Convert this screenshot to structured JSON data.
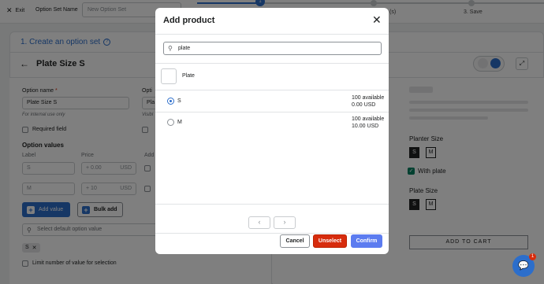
{
  "topbar": {
    "exit_label": "Exit",
    "option_set_name_label": "Option Set Name",
    "option_set_name_placeholder": "New Option Set",
    "step_current": "1",
    "step_2_partial": "(s)",
    "step_3_label": "3. Save"
  },
  "page": {
    "section_title": "1. Create an option set",
    "product_title": "Plate Size S",
    "option_name_label": "Option name",
    "option_name_required": "*",
    "option_name_value": "Plate Size S",
    "option_name_hint": "For internal use only",
    "option_title_label_partial": "Opti",
    "option_title_value_partial": "Pla",
    "option_title_hint_partial": "Visibl",
    "required_field_label": "Required field",
    "option_values_title": "Option values",
    "col_label": "Label",
    "col_price": "Price",
    "col_add_partial": "Add",
    "rows": [
      {
        "label": "S",
        "price": "0.00",
        "currency": "USD"
      },
      {
        "label": "M",
        "price": "10",
        "currency": "USD"
      }
    ],
    "add_value_label": "Add value",
    "bulk_add_label": "Bulk add",
    "default_option_placeholder": "Select default option value",
    "selected_tag": "S",
    "limit_label": "Limit number of value for selection"
  },
  "preview": {
    "planter_size_title": "Planter Size",
    "planter_swatches": [
      "S",
      "M"
    ],
    "with_plate_label": "With plate",
    "plate_size_title": "Plate Size",
    "plate_swatches": [
      "S",
      "M"
    ],
    "add_to_cart": "ADD TO CART"
  },
  "chat": {
    "badge": "1"
  },
  "modal": {
    "title": "Add product",
    "search_value": "plate",
    "product_name": "Plate",
    "variants": [
      {
        "name": "S",
        "available": "100 available",
        "price": "0.00 USD",
        "selected": true
      },
      {
        "name": "M",
        "available": "100 available",
        "price": "10.00 USD",
        "selected": false
      }
    ],
    "pagination": {
      "prev": "‹",
      "next": "›"
    },
    "cancel_label": "Cancel",
    "unselect_label": "Unselect",
    "confirm_label": "Confirm"
  },
  "colors": {
    "accent": "#2c6ecb",
    "danger": "#d72c0d",
    "confirm": "#5c7cf0",
    "success": "#008060"
  }
}
